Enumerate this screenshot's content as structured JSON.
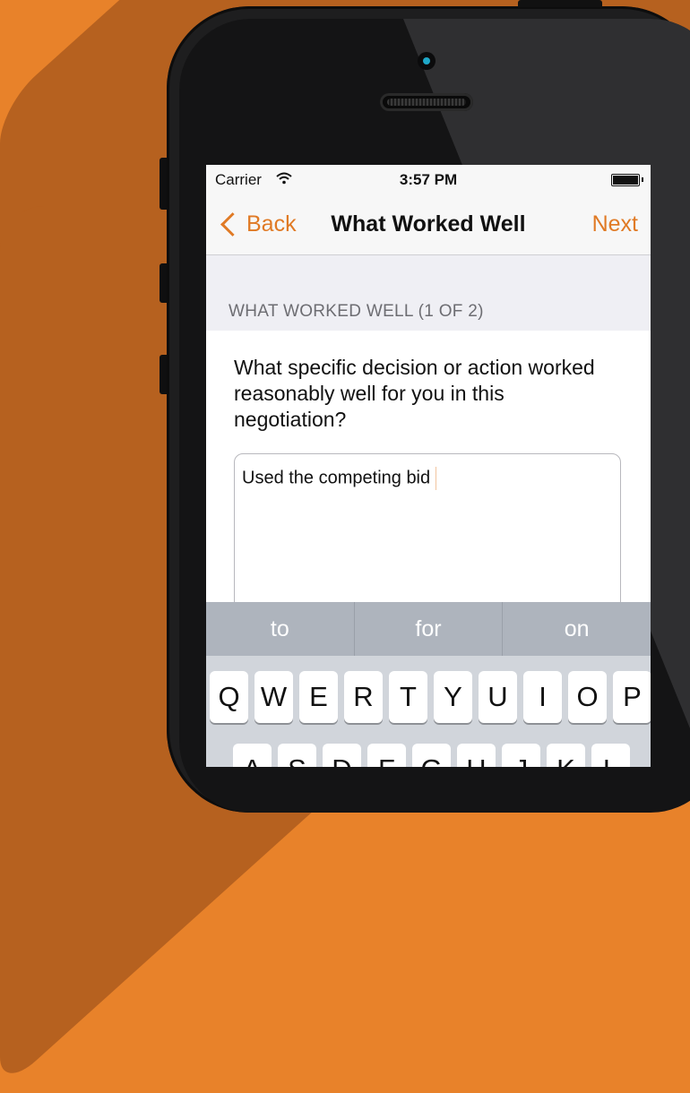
{
  "colors": {
    "background": "#e8822a",
    "accent": "#e07a25"
  },
  "status_bar": {
    "carrier": "Carrier",
    "time": "3:57 PM",
    "wifi_icon": "wifi-icon",
    "battery_icon": "battery-icon"
  },
  "nav": {
    "back_label": "Back",
    "title": "What Worked Well",
    "next_label": "Next"
  },
  "section": {
    "label": "WHAT WORKED WELL (1 OF 2)"
  },
  "question": "What specific decision or action worked reasonably well for you in this negotiation?",
  "answer": {
    "value": "Used the competing bid"
  },
  "suggestions": [
    "to",
    "for",
    "on"
  ],
  "keyboard": {
    "row1": [
      "Q",
      "W",
      "E",
      "R",
      "T",
      "Y",
      "U",
      "I",
      "O",
      "P"
    ],
    "row2": [
      "A",
      "S",
      "D",
      "F",
      "G",
      "H",
      "J",
      "K",
      "L"
    ]
  }
}
